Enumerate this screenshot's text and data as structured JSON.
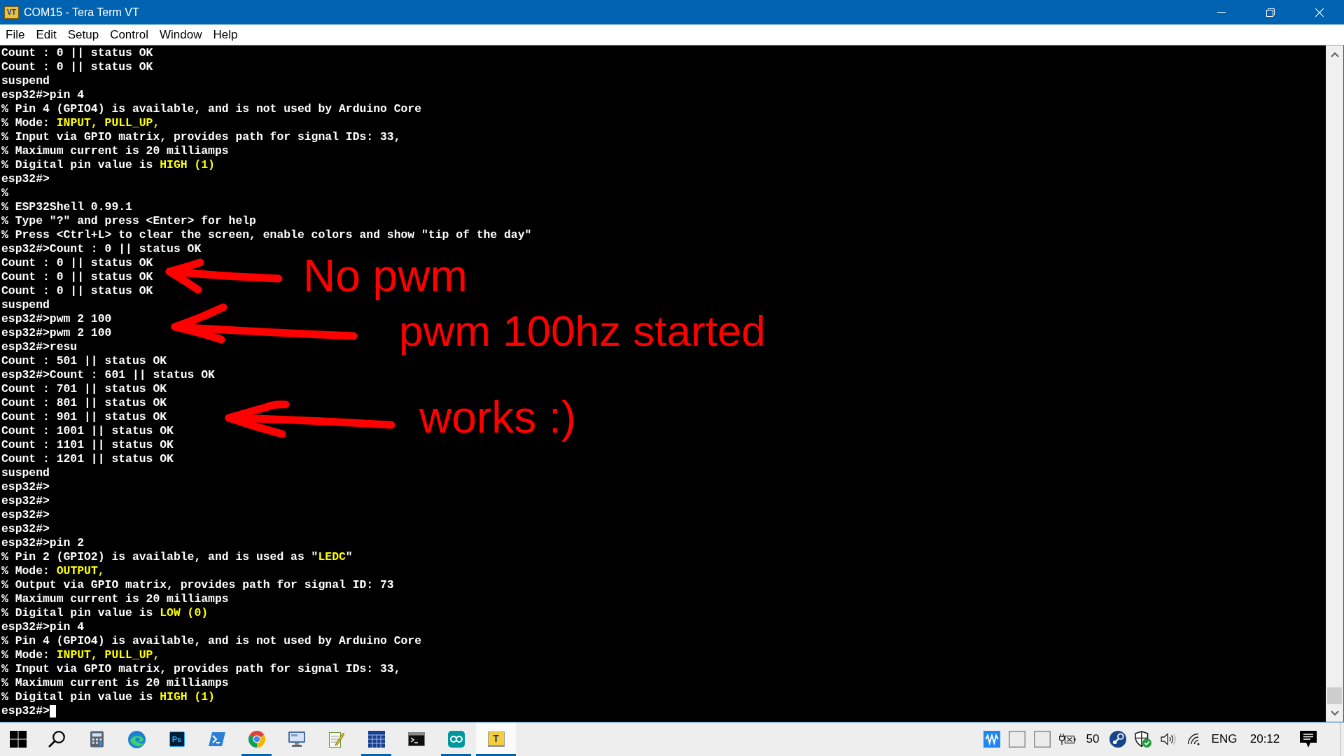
{
  "window": {
    "icon_label": "VT",
    "title": "COM15 - Tera Term VT"
  },
  "menu": [
    "File",
    "Edit",
    "Setup",
    "Control",
    "Window",
    "Help"
  ],
  "terminal": {
    "lines": [
      [
        {
          "text": "Count : 0 || status OK",
          "highlighted": false
        }
      ],
      [
        {
          "text": "Count : 0 || status OK",
          "highlighted": false
        }
      ],
      [
        {
          "text": "suspend",
          "highlighted": false
        }
      ],
      [
        {
          "text": "esp32#>pin 4",
          "highlighted": false
        }
      ],
      [
        {
          "text": "% Pin 4 (GPIO4) is available, and is not used by Arduino Core",
          "highlighted": false
        }
      ],
      [
        {
          "text": "% Mode: ",
          "highlighted": false
        },
        {
          "text": "INPUT, PULL_UP,",
          "highlighted": true
        }
      ],
      [
        {
          "text": "% Input via GPIO matrix, provides path for signal IDs: 33,",
          "highlighted": false
        }
      ],
      [
        {
          "text": "% Maximum current is 20 milliamps",
          "highlighted": false
        }
      ],
      [
        {
          "text": "% Digital pin value is ",
          "highlighted": false
        },
        {
          "text": "HIGH (1)",
          "highlighted": true
        }
      ],
      [
        {
          "text": "esp32#>",
          "highlighted": false
        }
      ],
      [
        {
          "text": "%",
          "highlighted": false
        }
      ],
      [
        {
          "text": "% ESP32Shell 0.99.1",
          "highlighted": false
        }
      ],
      [
        {
          "text": "% Type \"?\" and press <Enter> for help",
          "highlighted": false
        }
      ],
      [
        {
          "text": "% Press <Ctrl+L> to clear the screen, enable colors and show \"tip of the day\"",
          "highlighted": false
        }
      ],
      [
        {
          "text": "esp32#>Count : 0 || status OK",
          "highlighted": false
        }
      ],
      [
        {
          "text": "Count : 0 || status OK",
          "highlighted": false
        }
      ],
      [
        {
          "text": "Count : 0 || status OK",
          "highlighted": false
        }
      ],
      [
        {
          "text": "Count : 0 || status OK",
          "highlighted": false
        }
      ],
      [
        {
          "text": "suspend",
          "highlighted": false
        }
      ],
      [
        {
          "text": "esp32#>pwm 2 100",
          "highlighted": false
        }
      ],
      [
        {
          "text": "esp32#>pwm 2 100",
          "highlighted": false
        }
      ],
      [
        {
          "text": "esp32#>resu",
          "highlighted": false
        }
      ],
      [
        {
          "text": "Count : 501 || status OK",
          "highlighted": false
        }
      ],
      [
        {
          "text": "esp32#>Count : 601 || status OK",
          "highlighted": false
        }
      ],
      [
        {
          "text": "Count : 701 || status OK",
          "highlighted": false
        }
      ],
      [
        {
          "text": "Count : 801 || status OK",
          "highlighted": false
        }
      ],
      [
        {
          "text": "Count : 901 || status OK",
          "highlighted": false
        }
      ],
      [
        {
          "text": "Count : 1001 || status OK",
          "highlighted": false
        }
      ],
      [
        {
          "text": "Count : 1101 || status OK",
          "highlighted": false
        }
      ],
      [
        {
          "text": "Count : 1201 || status OK",
          "highlighted": false
        }
      ],
      [
        {
          "text": "suspend",
          "highlighted": false
        }
      ],
      [
        {
          "text": "esp32#>",
          "highlighted": false
        }
      ],
      [
        {
          "text": "esp32#>",
          "highlighted": false
        }
      ],
      [
        {
          "text": "esp32#>",
          "highlighted": false
        }
      ],
      [
        {
          "text": "esp32#>",
          "highlighted": false
        }
      ],
      [
        {
          "text": "esp32#>pin 2",
          "highlighted": false
        }
      ],
      [
        {
          "text": "% Pin 2 (GPIO2) is available, and is used as \"",
          "highlighted": false
        },
        {
          "text": "LEDC",
          "highlighted": true
        },
        {
          "text": "\"",
          "highlighted": false
        }
      ],
      [
        {
          "text": "% Mode: ",
          "highlighted": false
        },
        {
          "text": "OUTPUT,",
          "highlighted": true
        }
      ],
      [
        {
          "text": "% Output via GPIO matrix, provides path for signal ID: 73",
          "highlighted": false
        }
      ],
      [
        {
          "text": "% Maximum current is 20 milliamps",
          "highlighted": false
        }
      ],
      [
        {
          "text": "% Digital pin value is ",
          "highlighted": false
        },
        {
          "text": "LOW (0)",
          "highlighted": true
        }
      ],
      [
        {
          "text": "esp32#>pin 4",
          "highlighted": false
        }
      ],
      [
        {
          "text": "% Pin 4 (GPIO4) is available, and is not used by Arduino Core",
          "highlighted": false
        }
      ],
      [
        {
          "text": "% Mode: ",
          "highlighted": false
        },
        {
          "text": "INPUT, PULL_UP,",
          "highlighted": true
        }
      ],
      [
        {
          "text": "% Input via GPIO matrix, provides path for signal IDs: 33,",
          "highlighted": false
        }
      ],
      [
        {
          "text": "% Maximum current is 20 milliamps",
          "highlighted": false
        }
      ],
      [
        {
          "text": "% Digital pin value is ",
          "highlighted": false
        },
        {
          "text": "HIGH (1)",
          "highlighted": true
        }
      ],
      [
        {
          "text": "esp32#>",
          "highlighted": false
        }
      ]
    ],
    "cursor_visible": true
  },
  "annotations": [
    {
      "text": "No pwm"
    },
    {
      "text": "pwm 100hz started"
    },
    {
      "text": "works :)"
    }
  ],
  "taskbar": {
    "apps": [
      {
        "running": false,
        "selected": false
      },
      {
        "running": false,
        "selected": false
      },
      {
        "label": "Ps",
        "running": false,
        "selected": false
      },
      {
        "running": false,
        "selected": false
      },
      {
        "running": true,
        "selected": false
      },
      {
        "running": false,
        "selected": false
      },
      {
        "running": false,
        "selected": false
      },
      {
        "running": true,
        "selected": false
      },
      {
        "running": false,
        "selected": false
      },
      {
        "running": true,
        "selected": false
      },
      {
        "label": "T",
        "running": true,
        "selected": true
      }
    ],
    "tray_value": "50",
    "language": "ENG",
    "time": "20:12"
  }
}
